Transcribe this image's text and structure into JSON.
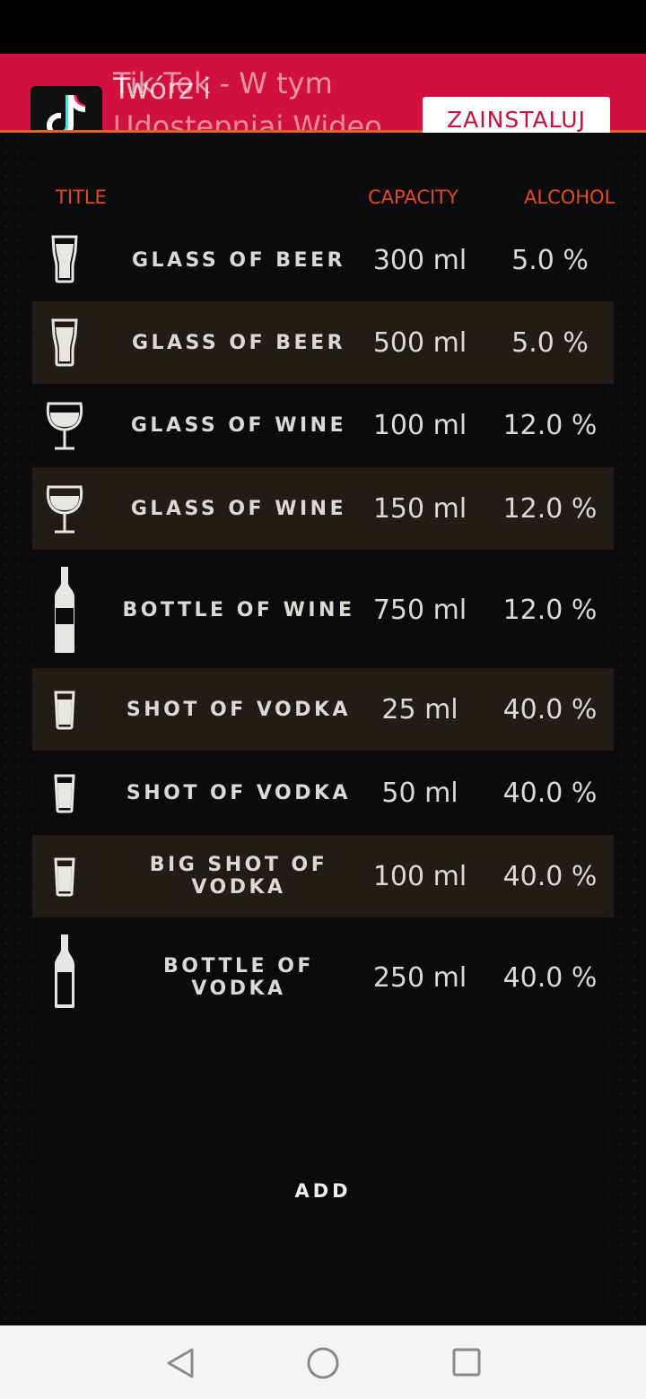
{
  "ad": {
    "title_line1_a": "Tik Tok - W tym",
    "title_line1_b": "Twórz i",
    "title_line2_a": "Udostępniaj Wideo",
    "title_line2_b": "Udostępniaj Wideo",
    "install_label": "ZAINSTALUJ",
    "icon": "tiktok-logo-icon",
    "background_color": "#d0103f"
  },
  "table": {
    "headers": {
      "title": "TITLE",
      "capacity": "CAPACITY",
      "alcohol": "ALCOHOL"
    },
    "header_color": "#e24a1f",
    "rows": [
      {
        "icon": "beer-glass-icon",
        "name": "GLASS OF BEER",
        "capacity": "300 ml",
        "alcohol": "5.0 %"
      },
      {
        "icon": "beer-glass-icon",
        "name": "GLASS OF BEER",
        "capacity": "500 ml",
        "alcohol": "5.0 %"
      },
      {
        "icon": "wine-glass-icon",
        "name": "GLASS OF WINE",
        "capacity": "100 ml",
        "alcohol": "12.0 %"
      },
      {
        "icon": "wine-glass-icon",
        "name": "GLASS OF WINE",
        "capacity": "150 ml",
        "alcohol": "12.0 %"
      },
      {
        "icon": "wine-bottle-icon",
        "name": "BOTTLE OF WINE",
        "capacity": "750 ml",
        "alcohol": "12.0 %"
      },
      {
        "icon": "shot-glass-icon",
        "name": "SHOT OF VODKA",
        "capacity": "25 ml",
        "alcohol": "40.0 %"
      },
      {
        "icon": "shot-glass-icon",
        "name": "SHOT OF VODKA",
        "capacity": "50 ml",
        "alcohol": "40.0 %"
      },
      {
        "icon": "shot-glass-icon",
        "name": "BIG SHOT OF VODKA",
        "capacity": "100 ml",
        "alcohol": "40.0 %"
      },
      {
        "icon": "vodka-bottle-icon",
        "name": "BOTTLE OF VODKA",
        "capacity": "250 ml",
        "alcohol": "40.0 %"
      }
    ]
  },
  "add_label": "ADD",
  "nav": {
    "back": "back-triangle-icon",
    "home": "home-circle-icon",
    "recents": "recents-square-icon"
  }
}
